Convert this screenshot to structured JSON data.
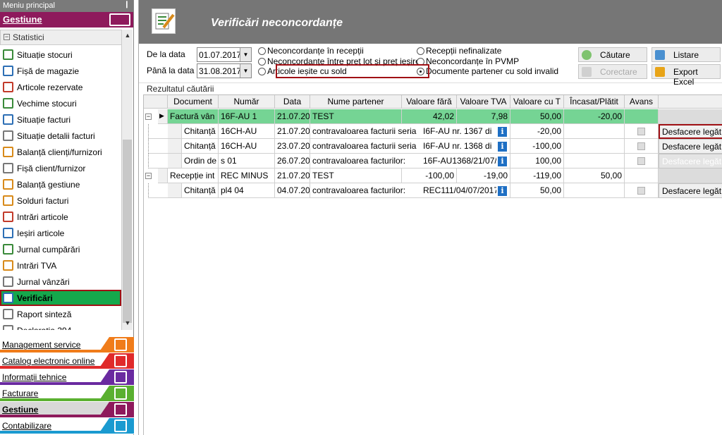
{
  "sidebar": {
    "menu_title": "Meniu principal",
    "pin_glyph": "❙",
    "top_category": "Gestiune",
    "section": "Statistici",
    "section_toggle": "−",
    "items": [
      {
        "label": "Situație stocuri",
        "icon": "stock-report-icon",
        "color": "#3a8a3a"
      },
      {
        "label": "Fișă de magazie",
        "icon": "warehouse-sheet-icon",
        "color": "#2d6fb5"
      },
      {
        "label": "Articole rezervate",
        "icon": "reserved-items-icon",
        "color": "#c23a2a"
      },
      {
        "label": "Vechime stocuri",
        "icon": "stock-age-icon",
        "color": "#3a8a3a"
      },
      {
        "label": "Situație facturi",
        "icon": "invoices-report-icon",
        "color": "#2d6fb5"
      },
      {
        "label": "Situație detalii facturi",
        "icon": "invoice-details-icon",
        "color": "#777777"
      },
      {
        "label": "Balanță clienți/furnizori",
        "icon": "partner-balance-icon",
        "color": "#d88a1a"
      },
      {
        "label": "Fișă client/furnizor",
        "icon": "partner-sheet-icon",
        "color": "#777777"
      },
      {
        "label": "Balanță gestiune",
        "icon": "stock-balance-icon",
        "color": "#d88a1a"
      },
      {
        "label": "Solduri facturi",
        "icon": "invoice-balances-icon",
        "color": "#d88a1a"
      },
      {
        "label": "Intrări articole",
        "icon": "item-inputs-icon",
        "color": "#c23a2a"
      },
      {
        "label": "Ieșiri articole",
        "icon": "item-outputs-icon",
        "color": "#2d6fb5"
      },
      {
        "label": "Jurnal cumpărări",
        "icon": "purchase-journal-icon",
        "color": "#3a8a3a"
      },
      {
        "label": "Intrări TVA",
        "icon": "vat-inputs-icon",
        "color": "#d88a1a"
      },
      {
        "label": "Jurnal vânzări",
        "icon": "sales-journal-icon",
        "color": "#777777"
      },
      {
        "label": "Verificări",
        "icon": "checks-icon",
        "color": "#2d6fb5",
        "active": true
      },
      {
        "label": "Raport sinteză",
        "icon": "summary-report-icon",
        "color": "#777777"
      },
      {
        "label": "Declarația 394",
        "icon": "declaration-icon",
        "color": "#777777"
      }
    ],
    "scroll_up": "▲",
    "scroll_down": "▼",
    "categories": [
      {
        "label": "Management service",
        "color": "#f07c1a"
      },
      {
        "label": "Catalog electronic online",
        "color": "#e02a2a"
      },
      {
        "label": "Informații tehnice",
        "color": "#6a2aa0"
      },
      {
        "label": "Facturare",
        "color": "#5ab030"
      },
      {
        "label": "Gestiune",
        "color": "#8e1a5c",
        "active": true
      },
      {
        "label": "Contabilizare",
        "color": "#1a9ad0"
      }
    ]
  },
  "header": {
    "title": "Verificări neconcordanțe"
  },
  "filters": {
    "from_label": "De la data",
    "from_value": "01.07.2017",
    "to_label": "Până la data",
    "to_value": "31.08.2017",
    "dropdown_glyph": "▼",
    "radios": [
      {
        "label": "Neconcordanțe în recepții",
        "checked": false
      },
      {
        "label": "Neconcordanțe între preț lot și preț ieșire",
        "checked": false
      },
      {
        "label": "Articole ieșite cu sold",
        "checked": false
      },
      {
        "label": "Recepții nefinalizate",
        "checked": false
      },
      {
        "label": "Neconcordanțe în PVMP",
        "checked": false
      },
      {
        "label": "Documente partener cu sold invalid",
        "checked": true
      }
    ],
    "buttons": {
      "search": "Căutare",
      "print": "Listare",
      "correct": "Corectare",
      "export": "Export Excel"
    }
  },
  "results": {
    "label": "Rezultatul căutării",
    "columns": [
      "Document",
      "Număr",
      "Data",
      "Nume partener",
      "Valoare fără",
      "Valoare TVA",
      "Valoare cu T",
      "Încasat/Plătit",
      "Avans"
    ],
    "groups": [
      {
        "doc": "Factură vân",
        "number": "16F-AU  1",
        "date": "21.07.20",
        "partner": "TEST",
        "val_no_vat": "42,02",
        "vat": "7,98",
        "val_vat": "50,00",
        "paid": "-20,00",
        "rows": [
          {
            "doc": "Chitanță",
            "number": "16CH-AU",
            "date": "21.07.20",
            "partner_a": "contravaloarea facturii seria",
            "partner_b": "I6F-AU nr. 1367 di",
            "val_vat": "-20,00",
            "action": "Desfacere legăt",
            "action_state": "highlight"
          },
          {
            "doc": "Chitanță",
            "number": "16CH-AU",
            "date": "23.07.20",
            "partner_a": "contravaloarea facturii seria",
            "partner_b": "I6F-AU nr. 1368 di",
            "val_vat": "-100,00",
            "action": "Desfacere legăt",
            "action_state": "normal"
          },
          {
            "doc": "Ordin de",
            "number": "s 01",
            "date": "26.07.20",
            "partner_a": "contravaloarea facturilor:",
            "partner_b": "16F-AU1368/21/07/2",
            "val_vat": "100,00",
            "action": "Desfacere legăt",
            "action_state": "disabled"
          }
        ]
      },
      {
        "doc": "Recepție int",
        "number": "REC MINUS",
        "date": "21.07.20",
        "partner": "TEST",
        "val_no_vat": "-100,00",
        "vat": "-19,00",
        "val_vat": "-119,00",
        "paid": "50,00",
        "rows": [
          {
            "doc": "Chitanță",
            "number": "pl4 04",
            "date": "04.07.20",
            "partner_a": "contravaloarea facturilor:",
            "partner_b": "REC111/04/07/2017,  R",
            "val_vat": "50,00",
            "action": "Desfacere legăt",
            "action_state": "normal"
          }
        ]
      }
    ],
    "info_glyph": "i",
    "collapse_glyph": "−",
    "current_row_glyph": "▶"
  }
}
